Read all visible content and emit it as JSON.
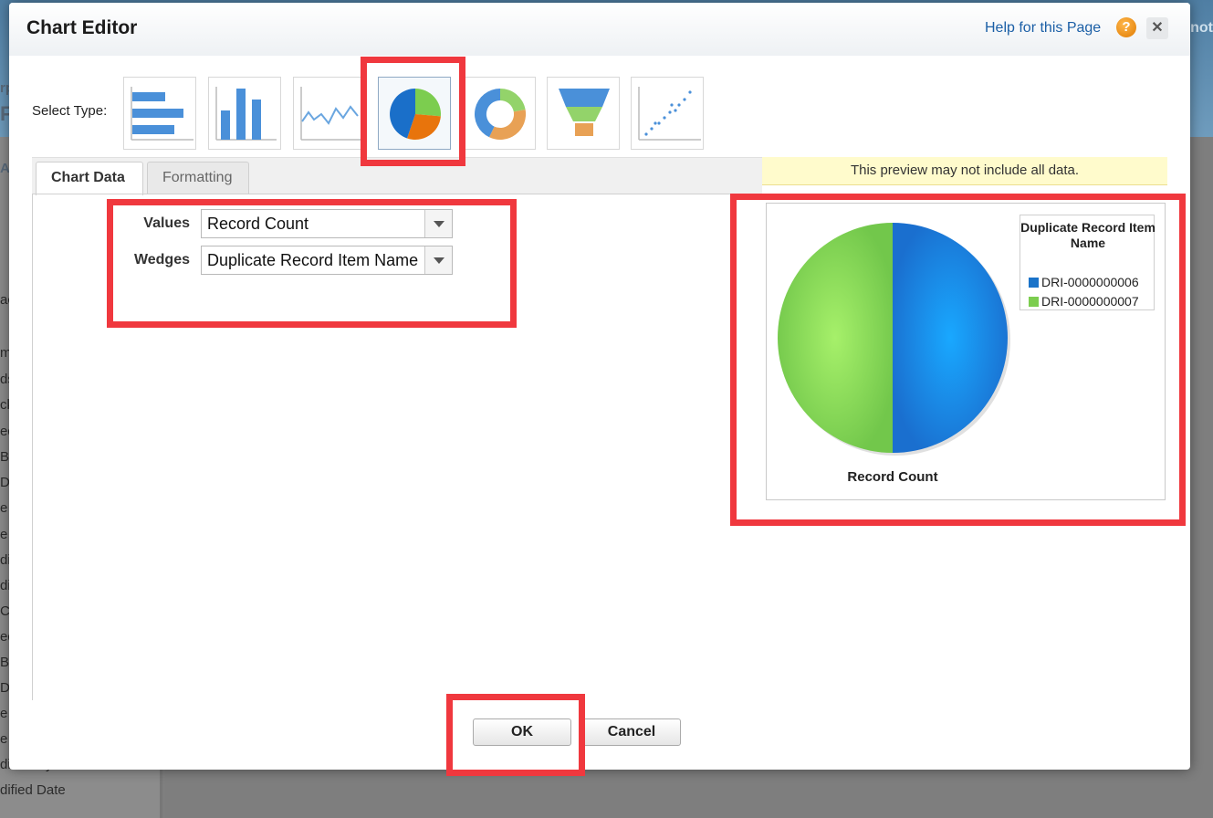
{
  "background": {
    "top_right_fragment": "not",
    "left_fragments": [
      "rp",
      "F",
      "A",
      "ac",
      "m",
      "ds",
      "ck",
      "ed",
      "B",
      "D",
      "e",
      "e",
      "di",
      "di",
      "C",
      "ed",
      "B",
      "D",
      "e",
      "e",
      "dified By: Full Name",
      "dified Date"
    ]
  },
  "dialog": {
    "title": "Chart Editor",
    "help_link": "Help for this Page",
    "help_icon": "?",
    "close_icon": "✕"
  },
  "select_type": {
    "label": "Select Type:",
    "types": [
      "horizontal-bar",
      "vertical-bar",
      "line",
      "pie",
      "donut",
      "funnel",
      "scatter"
    ],
    "selected": "pie"
  },
  "tabs": [
    {
      "label": "Chart Data",
      "active": true
    },
    {
      "label": "Formatting",
      "active": false
    }
  ],
  "chart_data_form": {
    "values_label": "Values",
    "values_selected": "Record Count",
    "wedges_label": "Wedges",
    "wedges_selected": "Duplicate Record Item Name"
  },
  "preview": {
    "note": "This preview may not include all data."
  },
  "chart_data": {
    "type": "pie",
    "legend": {
      "title": "Duplicate Record Item Name",
      "placement": "top-right"
    },
    "slices": [
      {
        "label": "DRI-0000000006",
        "value": 1,
        "color": "#1a73c9"
      },
      {
        "label": "DRI-0000000007",
        "value": 1,
        "color": "#7ccd4f"
      }
    ],
    "xlabel": "Record Count"
  },
  "buttons": {
    "ok": "OK",
    "cancel": "Cancel"
  },
  "annotation_color": "#f0383e"
}
